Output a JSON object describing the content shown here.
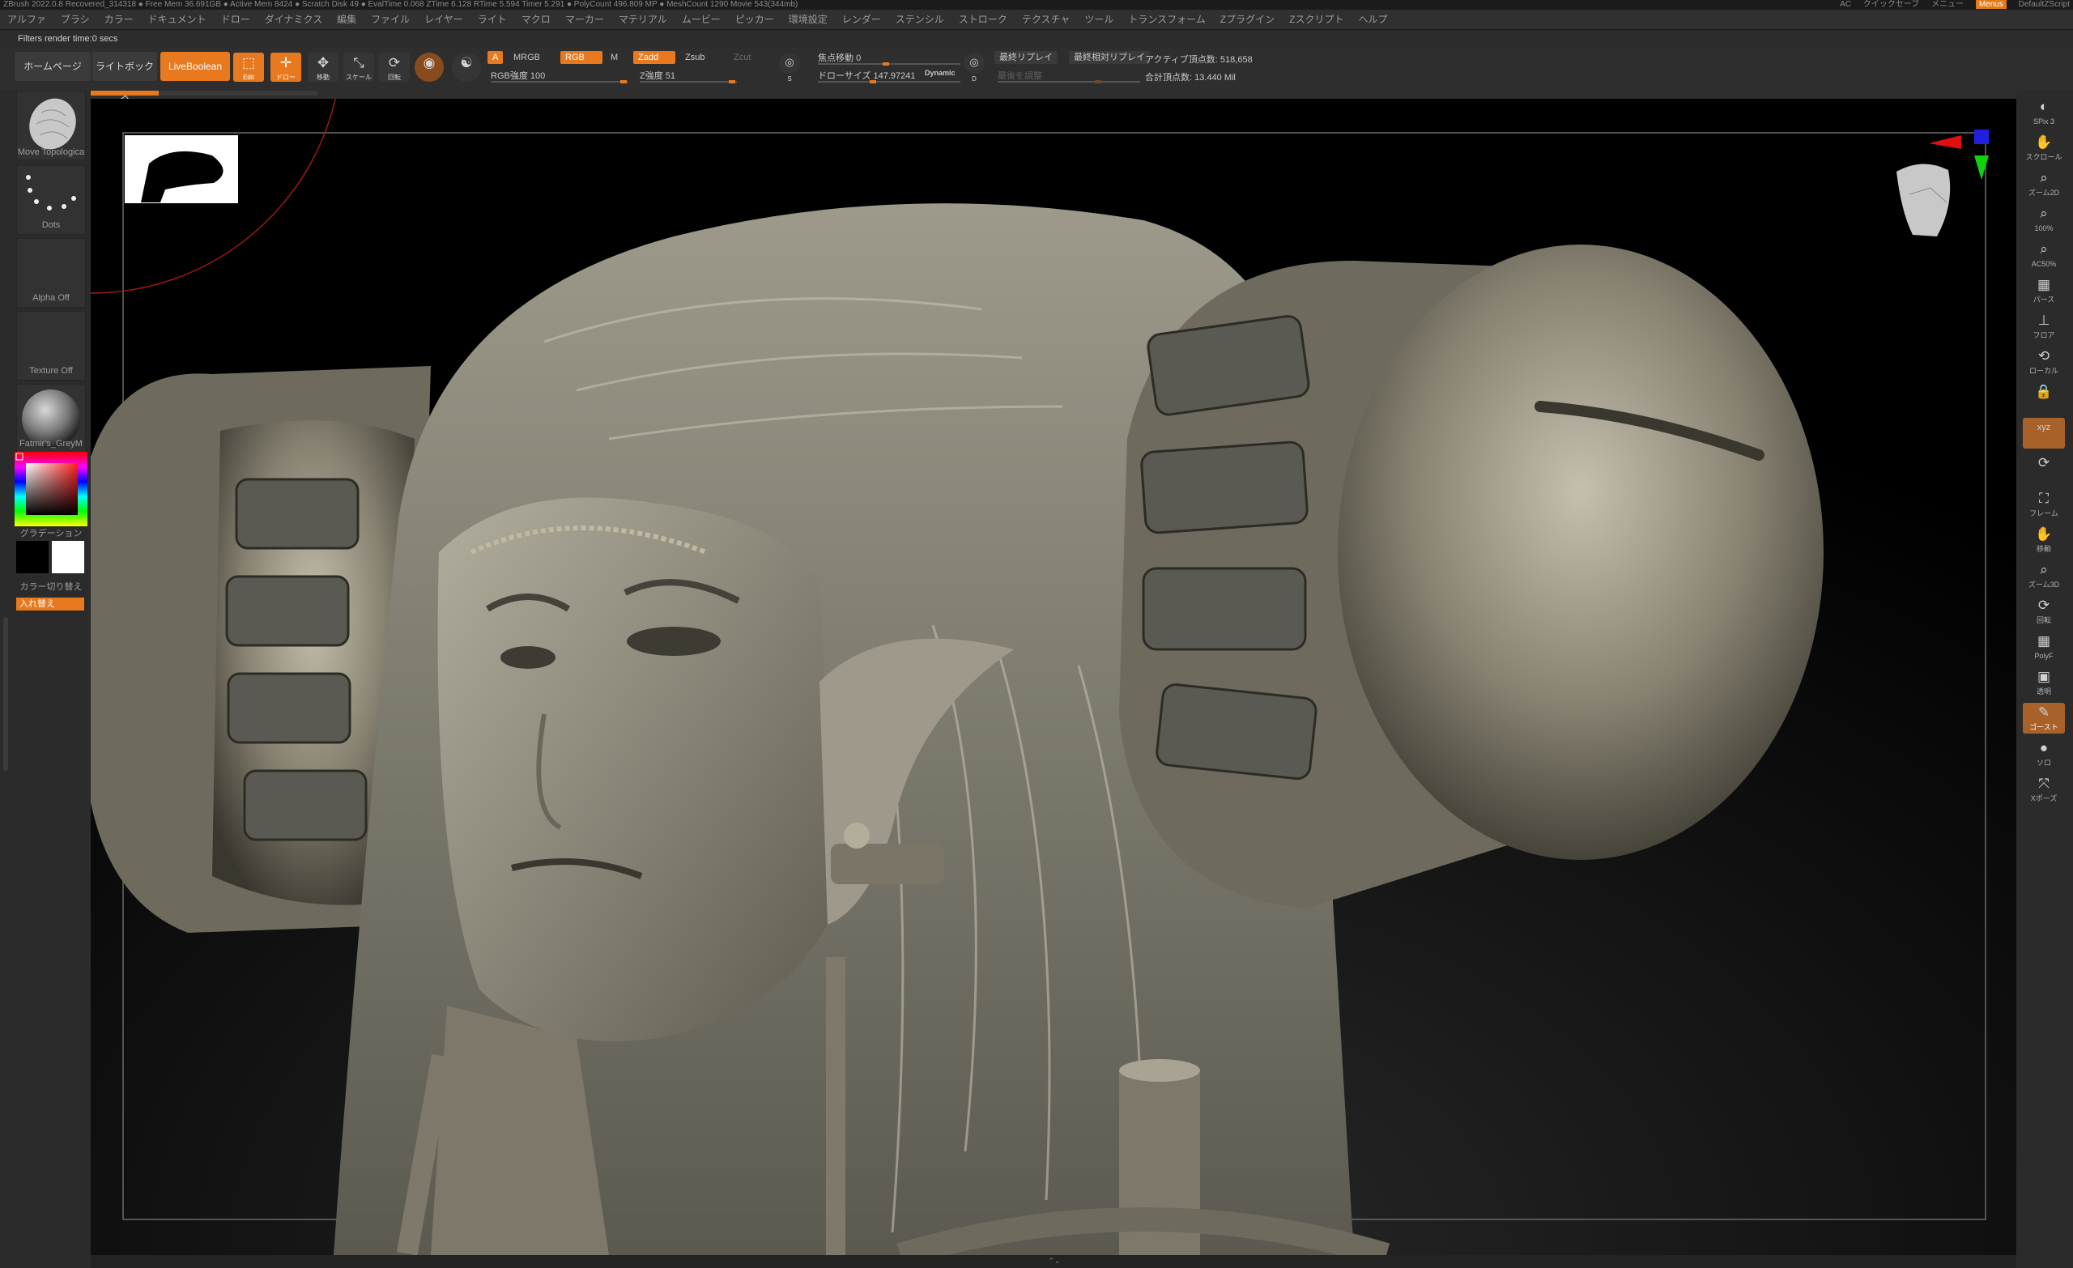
{
  "titlebar": {
    "app": "ZBrush 2022.0.8",
    "project": "Recovered_314318",
    "stats": "● Free Mem 36.691GB ● Active Mem 8424 ● Scratch Disk 49 ● EvalTime 0.068 ZTime 6.128 RTime 5.594 Timer 5.291 ● PolyCount 496.809 MP ● MeshCount 1290 Movie 543(344mb)",
    "right_items": [
      "AC",
      "クイックセーブ",
      "メニュー"
    ],
    "material_button": "Menus",
    "script": "DefaultZScript"
  },
  "menu": [
    "アルファ",
    "ブラシ",
    "カラー",
    "ドキュメント",
    "ドロー",
    "ダイナミクス",
    "編集",
    "ファイル",
    "レイヤー",
    "ライト",
    "マクロ",
    "マーカー",
    "マテリアル",
    "ムービー",
    "ピッカー",
    "環境設定",
    "レンダー",
    "ステンシル",
    "ストローク",
    "テクスチャ",
    "ツール",
    "トランスフォーム",
    "Zプラグイン",
    "Zスクリプト",
    "ヘルプ"
  ],
  "status": {
    "text": "Filters render time:0 secs"
  },
  "shelf": {
    "home": "ホームページ",
    "lightbox": "ライトボックス",
    "liveboolean": "LiveBoolean",
    "edit": "Edit",
    "draw": "ドロー",
    "move": "移動",
    "scale": "スケール",
    "rotate": "回転",
    "a": "A",
    "mrgb": "MRGB",
    "rgb": "RGB",
    "m": "M",
    "zadd": "Zadd",
    "zsub": "Zsub",
    "zcut": "Zcut",
    "rgb_intensity_label": "RGB強度",
    "rgb_intensity": "100",
    "z_intensity_label": "Z強度",
    "z_intensity": "51",
    "focal_label": "焦点移動",
    "focal": "0",
    "draw_size_label": "ドローサイズ",
    "draw_size": "147.97241",
    "dynamic": "Dynamic",
    "s": "S",
    "d": "D",
    "replay_last": "最終リプレイ",
    "replay_last_rel": "最終相対リプレイ",
    "adjust_last": "最後を調整",
    "active_points_label": "アクティブ頂点数:",
    "active_points": "518,658",
    "total_points_label": "合計頂点数:",
    "total_points": "13.440 Mil",
    "progress": 0.3
  },
  "left_tray": {
    "brush": "Move Topologica",
    "stroke": "Dots",
    "alpha": "Alpha Off",
    "texture": "Texture Off",
    "material": "Fatmir's_GreyM",
    "gradient": "グラデーション",
    "switch_color": "カラー切り替え",
    "swap": "入れ替え"
  },
  "right_tray": [
    {
      "icon": "bpr-icon",
      "glyph": "◐",
      "label": "SPix 3"
    },
    {
      "icon": "scroll-icon",
      "glyph": "✋",
      "label": "スクロール"
    },
    {
      "icon": "zoom-icon",
      "glyph": "⌕",
      "label": "ズーム2D"
    },
    {
      "icon": "actual-icon",
      "glyph": "⌕",
      "label": "100%"
    },
    {
      "icon": "aahalf-icon",
      "glyph": "⌕",
      "label": "AC50%"
    },
    {
      "icon": "persp-icon",
      "glyph": "▦",
      "label": "パース"
    },
    {
      "icon": "floor-icon",
      "glyph": "⊥",
      "label": "フロア"
    },
    {
      "icon": "localsym-icon",
      "glyph": "⟲",
      "label": "ローカル"
    },
    {
      "icon": "lock-icon",
      "glyph": "🔒",
      "label": ""
    },
    {
      "icon": "xyz-icon",
      "glyph": "xyz",
      "label": ""
    },
    {
      "icon": "sym-icon",
      "glyph": "⟳",
      "label": ""
    },
    {
      "icon": "frame-icon",
      "glyph": "⛶",
      "label": "フレーム"
    },
    {
      "icon": "move-icon",
      "glyph": "✋",
      "label": "移動"
    },
    {
      "icon": "zoom3d-icon",
      "glyph": "⌕",
      "label": "ズーム3D"
    },
    {
      "icon": "rotate-icon",
      "glyph": "⟳",
      "label": "回転"
    },
    {
      "icon": "polyf-icon",
      "glyph": "▦",
      "label": "PolyF"
    },
    {
      "icon": "transp-icon",
      "glyph": "▣",
      "label": "透明"
    },
    {
      "icon": "ghost-icon",
      "glyph": "✎",
      "label": "ゴースト"
    },
    {
      "icon": "solo-icon",
      "glyph": "●",
      "label": "ソロ"
    },
    {
      "icon": "xpose-icon",
      "glyph": "⤧",
      "label": "Xポーズ"
    }
  ],
  "colors": {
    "accent": "#e8791e",
    "active": "#a9612a",
    "background": "#2a2a2a",
    "sculpt": "#8c8576"
  }
}
